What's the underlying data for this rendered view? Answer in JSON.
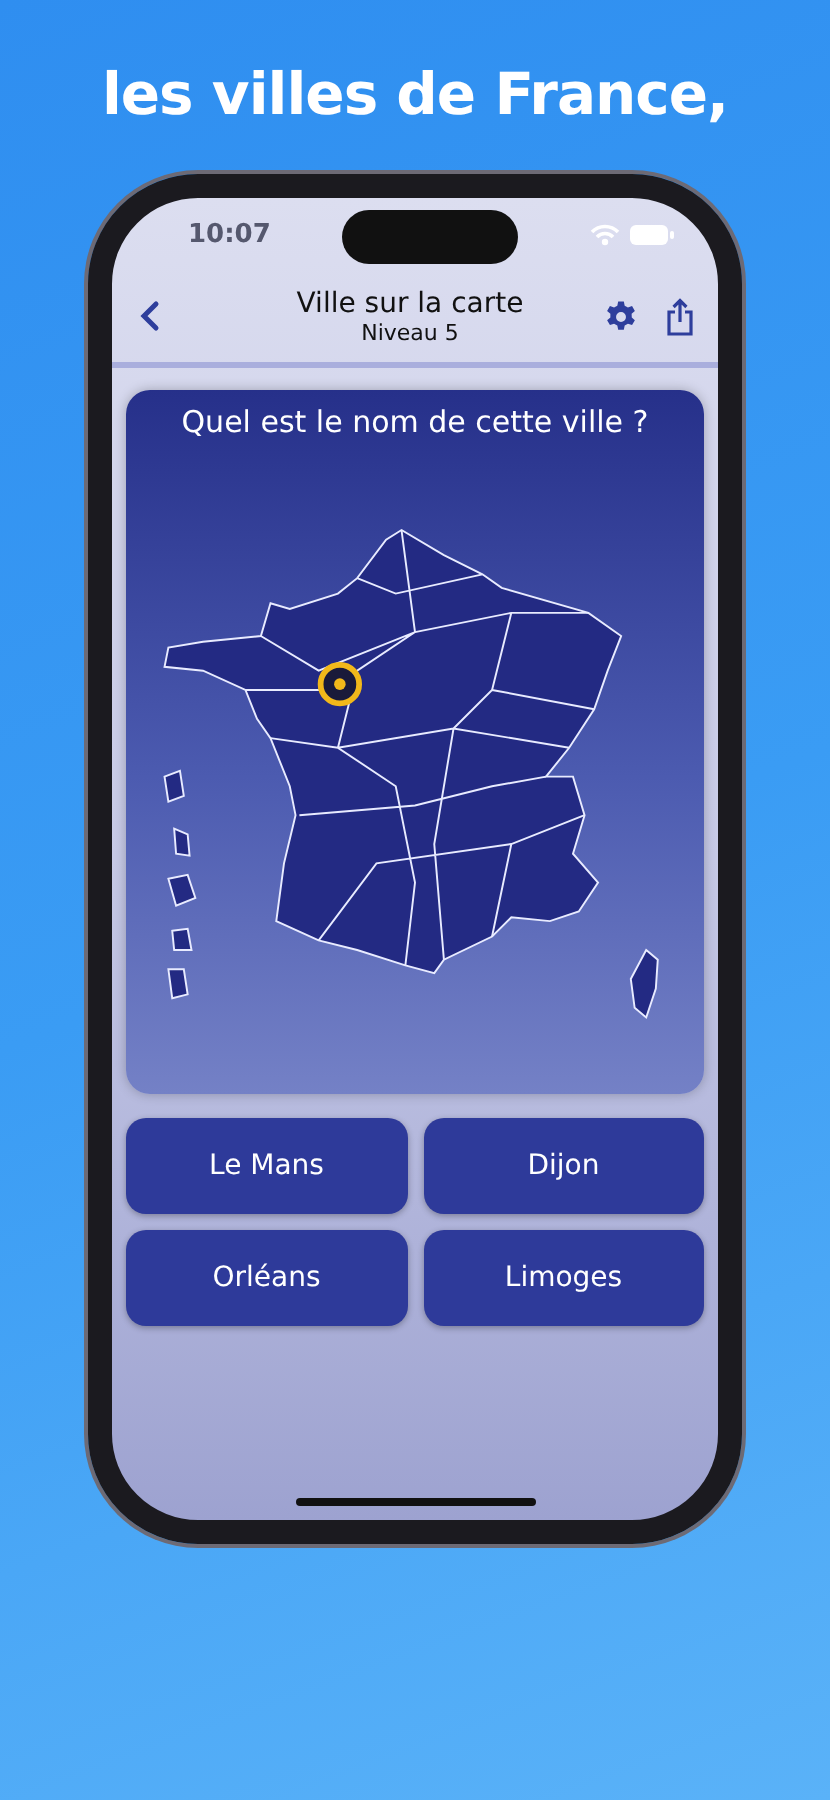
{
  "headline": "les villes de France,",
  "status_bar": {
    "time": "10:07"
  },
  "nav": {
    "title": "Ville sur la carte",
    "subtitle": "Niveau 5"
  },
  "question": "Quel est le nom de cette ville ?",
  "answers": [
    {
      "label": "Le Mans"
    },
    {
      "label": "Dijon"
    },
    {
      "label": "Orléans"
    },
    {
      "label": "Limoges"
    }
  ]
}
